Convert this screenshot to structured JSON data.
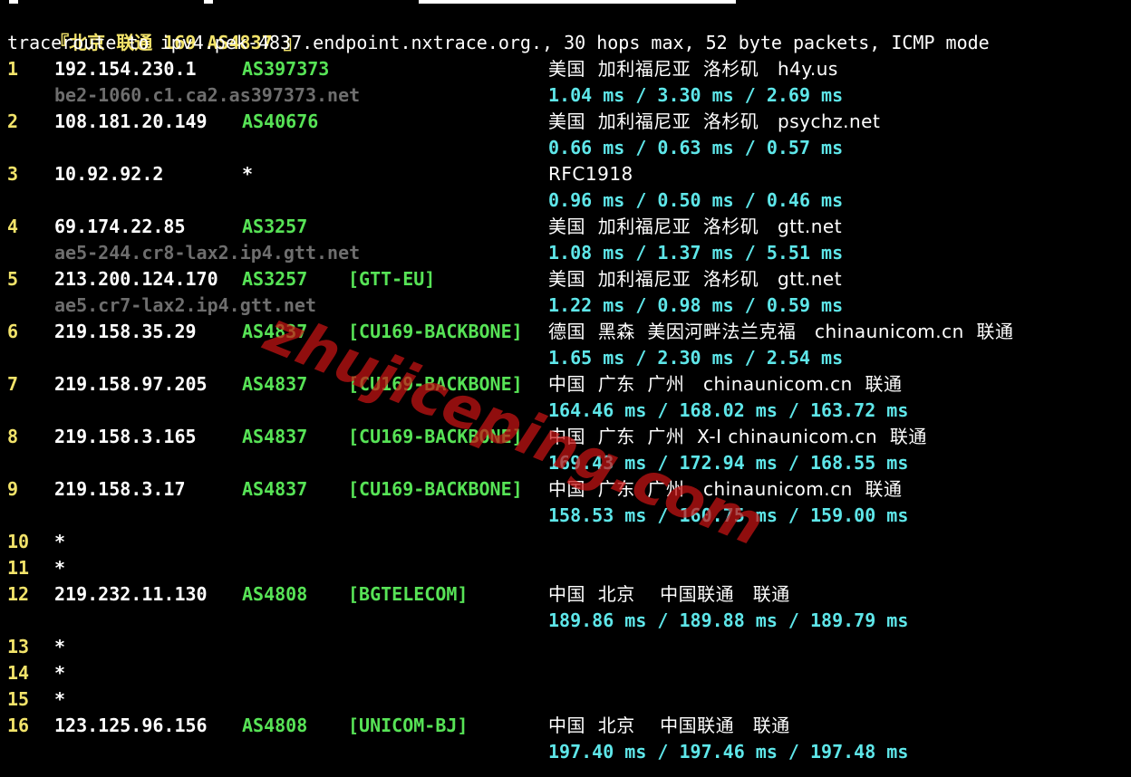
{
  "colors": {
    "background": "#000000",
    "hop_number": "#f2e36a",
    "ip": "#ffffff",
    "asn": "#57e356",
    "tag": "#57e356",
    "rtt": "#5ee6e9",
    "hostname": "#6e6e6e",
    "header": "#f2e36a",
    "watermark": "#c81414"
  },
  "header": {
    "bracket_open": "『",
    "city": "北京",
    "carrier": "联通",
    "route": "169 AS4837",
    "bracket_close": "』"
  },
  "command_line": "traceroute to ipv4.pek-4837.endpoint.nxtrace.org., 30 hops max, 52 byte packets, ICMP mode",
  "hops": [
    {
      "n": "1",
      "ip": "192.154.230.1",
      "asn": "AS397373",
      "tag": "",
      "geo": "美国  加利福尼亚  洛杉矶   h4y.us",
      "hostname": "be2-1060.c1.ca2.as397373.net",
      "rtt": "1.04 ms / 3.30 ms / 2.69 ms"
    },
    {
      "n": "2",
      "ip": "108.181.20.149",
      "asn": "AS40676",
      "tag": "",
      "geo": "美国  加利福尼亚  洛杉矶   psychz.net",
      "hostname": "",
      "rtt": "0.66 ms / 0.63 ms / 0.57 ms"
    },
    {
      "n": "3",
      "ip": "10.92.92.2",
      "asn": "*",
      "tag": "",
      "geo": "RFC1918",
      "hostname": "",
      "rtt": "0.96 ms / 0.50 ms / 0.46 ms"
    },
    {
      "n": "4",
      "ip": "69.174.22.85",
      "asn": "AS3257",
      "tag": "",
      "geo": "美国  加利福尼亚  洛杉矶   gtt.net",
      "hostname": "ae5-244.cr8-lax2.ip4.gtt.net",
      "rtt": "1.08 ms / 1.37 ms / 5.51 ms"
    },
    {
      "n": "5",
      "ip": "213.200.124.170",
      "asn": "AS3257",
      "tag": "[GTT-EU]",
      "geo": "美国  加利福尼亚  洛杉矶   gtt.net",
      "hostname": "ae5.cr7-lax2.ip4.gtt.net",
      "rtt": "1.22 ms / 0.98 ms / 0.59 ms"
    },
    {
      "n": "6",
      "ip": "219.158.35.29",
      "asn": "AS4837",
      "tag": "[CU169-BACKBONE]",
      "geo": "德国  黑森  美因河畔法兰克福   chinaunicom.cn  联通",
      "hostname": "",
      "rtt": "1.65 ms / 2.30 ms / 2.54 ms"
    },
    {
      "n": "7",
      "ip": "219.158.97.205",
      "asn": "AS4837",
      "tag": "[CU169-BACKBONE]",
      "geo": "中国  广东  广州   chinaunicom.cn  联通",
      "hostname": "",
      "rtt": "164.46 ms / 168.02 ms / 163.72 ms"
    },
    {
      "n": "8",
      "ip": "219.158.3.165",
      "asn": "AS4837",
      "tag": "[CU169-BACKBONE]",
      "geo": "中国  广东  广州  X-I chinaunicom.cn  联通",
      "hostname": "",
      "rtt": "169.43 ms / 172.94 ms / 168.55 ms"
    },
    {
      "n": "9",
      "ip": "219.158.3.17",
      "asn": "AS4837",
      "tag": "[CU169-BACKBONE]",
      "geo": "中国  广东  广州   chinaunicom.cn  联通",
      "hostname": "",
      "rtt": "158.53 ms / 160.75 ms / 159.00 ms"
    },
    {
      "n": "10",
      "ip": "*",
      "asn": "",
      "tag": "",
      "geo": "",
      "hostname": "",
      "rtt": ""
    },
    {
      "n": "11",
      "ip": "*",
      "asn": "",
      "tag": "",
      "geo": "",
      "hostname": "",
      "rtt": ""
    },
    {
      "n": "12",
      "ip": "219.232.11.130",
      "asn": "AS4808",
      "tag": "[BGTELECOM]",
      "geo": "中国  北京    中国联通   联通",
      "hostname": "",
      "rtt": "189.86 ms / 189.88 ms / 189.79 ms"
    },
    {
      "n": "13",
      "ip": "*",
      "asn": "",
      "tag": "",
      "geo": "",
      "hostname": "",
      "rtt": ""
    },
    {
      "n": "14",
      "ip": "*",
      "asn": "",
      "tag": "",
      "geo": "",
      "hostname": "",
      "rtt": ""
    },
    {
      "n": "15",
      "ip": "*",
      "asn": "",
      "tag": "",
      "geo": "",
      "hostname": "",
      "rtt": ""
    },
    {
      "n": "16",
      "ip": "123.125.96.156",
      "asn": "AS4808",
      "tag": "[UNICOM-BJ]",
      "geo": "中国  北京    中国联通   联通",
      "hostname": "",
      "rtt": "197.40 ms / 197.46 ms / 197.48 ms"
    }
  ],
  "watermark": "zhujiceping.com"
}
